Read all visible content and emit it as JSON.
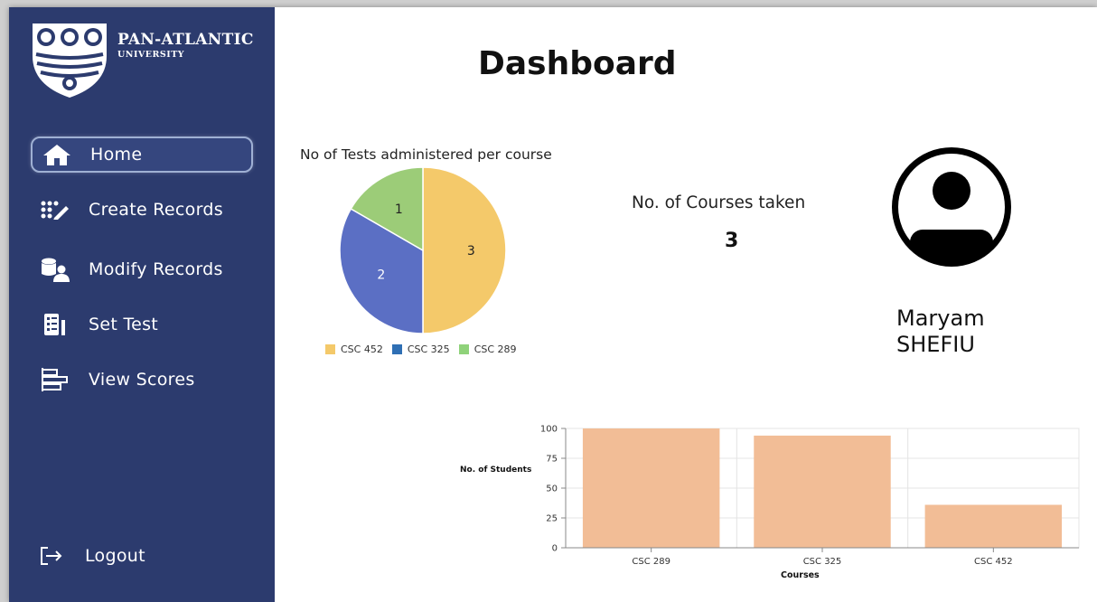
{
  "brand": {
    "name": "PAN-ATLANTIC",
    "subtitle": "UNIVERSITY"
  },
  "sidebar": {
    "items": [
      {
        "label": "Home",
        "icon": "home-icon",
        "active": true
      },
      {
        "label": "Create Records",
        "icon": "create-records-icon"
      },
      {
        "label": "Modify Records",
        "icon": "modify-records-icon"
      },
      {
        "label": "Set Test",
        "icon": "set-test-icon"
      },
      {
        "label": "View Scores",
        "icon": "view-scores-icon"
      }
    ],
    "logout_label": "Logout"
  },
  "main": {
    "title": "Dashboard",
    "courses_taken_label": "No. of Courses taken",
    "courses_taken_value": "3",
    "profile": {
      "first_name": "Maryam",
      "last_name": "SHEFIU"
    }
  },
  "colors": {
    "sidebar": "#2c3b6e",
    "bar": "#f2bd96"
  },
  "chart_data": [
    {
      "type": "pie",
      "title": "No of Tests administered per course",
      "slices": [
        {
          "label": "CSC 452",
          "value": 3,
          "color": "#f4c96a"
        },
        {
          "label": "CSC 325",
          "value": 2,
          "color": "#5b6fc4"
        },
        {
          "label": "CSC 289",
          "value": 1,
          "color": "#9ccc78"
        }
      ],
      "legend_entries": [
        {
          "label": "CSC 452",
          "color": "#f4c96a"
        },
        {
          "label": "CSC 325",
          "color": "#2f6fb4"
        },
        {
          "label": "CSC 289",
          "color": "#8fd27a"
        }
      ],
      "legend_position": "bottom"
    },
    {
      "type": "bar",
      "categories": [
        "CSC 289",
        "CSC 325",
        "CSC 452"
      ],
      "values": [
        100,
        94,
        36
      ],
      "xlabel": "Courses",
      "ylabel": "No. of Students",
      "ylim": [
        0,
        100
      ],
      "yticks": [
        0,
        25,
        50,
        75,
        100
      ],
      "grid": true
    }
  ]
}
